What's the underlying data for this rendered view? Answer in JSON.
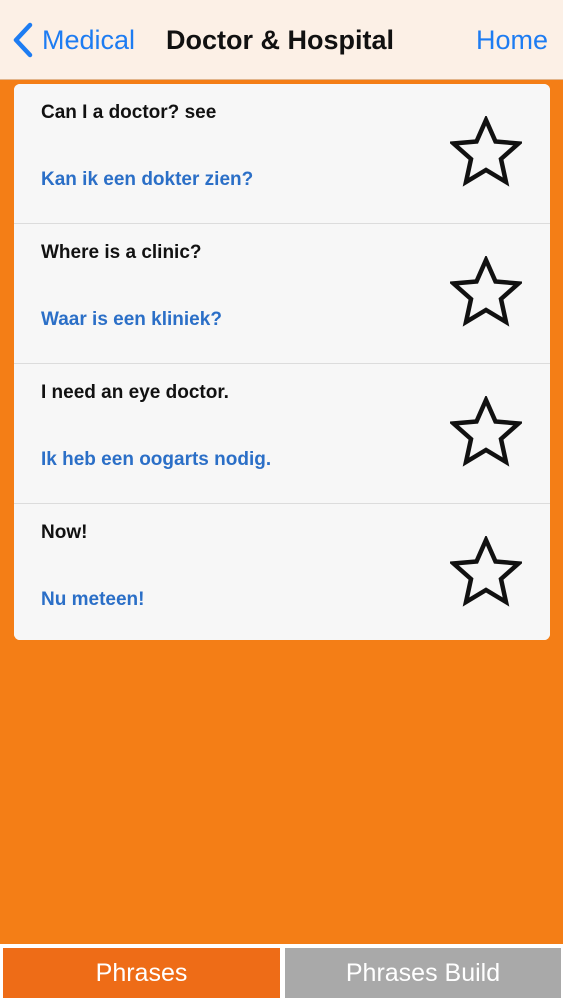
{
  "navbar": {
    "back_label": "Medical",
    "back_icon": "chevron-left-icon",
    "title": "Doctor & Hospital",
    "home_label": "Home"
  },
  "phrases": [
    {
      "english": "Can I a doctor? see",
      "dutch": "Kan ik een dokter zien?",
      "favorite": false
    },
    {
      "english": "Where is a clinic?",
      "dutch": "Waar is een kliniek?",
      "favorite": false
    },
    {
      "english": "I need an eye doctor.",
      "dutch": "Ik heb een oogarts nodig.",
      "favorite": false
    },
    {
      "english": "Now!",
      "dutch": "Nu meteen!",
      "favorite": false
    }
  ],
  "tabs": {
    "phrases_label": "Phrases",
    "build_label": "Phrases Build",
    "selected": "Phrases"
  },
  "colors": {
    "background": "#f47e16",
    "navbar": "#fcf0e6",
    "link_blue": "#1d7cf2",
    "translation_blue": "#2b6fc7",
    "tab_active": "#ee6c17",
    "tab_inactive": "#a9a9a9"
  }
}
